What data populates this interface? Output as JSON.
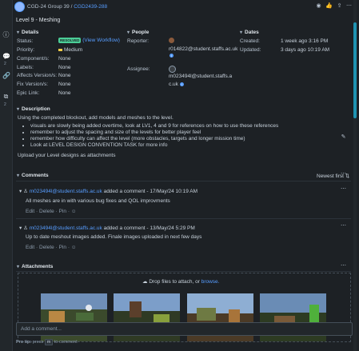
{
  "breadcrumb": {
    "project": "CGD-24 Group 39",
    "separator": "/",
    "issue_key": "CGD2439-288"
  },
  "issue_title": "Level 9 - Meshing",
  "rail": {
    "comments_count": "2"
  },
  "details": {
    "heading": "Details",
    "status_label": "Status:",
    "status_value": "RESOLVED",
    "status_link": "(View Workflow)",
    "priority_label": "Priority:",
    "priority_value": "Medium",
    "component_label": "Component/s:",
    "component_value": "None",
    "labels_label": "Labels:",
    "labels_value": "None",
    "affects_label": "Affects Version/s:",
    "affects_value": "None",
    "fix_label": "Fix Version/s:",
    "fix_value": "None",
    "epic_label": "Epic Link:",
    "epic_value": "None"
  },
  "people": {
    "heading": "People",
    "reporter_label": "Reporter:",
    "reporter_value": "r014822@student.staffs.ac.uk",
    "assignee_label": "Assignee:",
    "assignee_value_1": "m023494l@student.staffs.a",
    "assignee_value_2": "c.uk"
  },
  "dates": {
    "heading": "Dates",
    "created_label": "Created:",
    "created_value": "1 week ago 3:16 PM",
    "updated_label": "Updated:",
    "updated_value": "3 days ago 10:19 AM"
  },
  "description": {
    "heading": "Description",
    "intro": "Using the completed blockout, add models and meshes to the level.",
    "bullets": [
      "visuals are slowly being added overtime, look at LV1, 4 and 9 for references on how to use these references",
      "remember to adjust the spacing and size of the levels for better player feel",
      "remember how difficulty can affect the level (more obstacles, targets and longer mission time)",
      "Look at LEVEL DESIGN CONVENTION TASK for more info"
    ],
    "outro": "Upload your Level designs as attachments"
  },
  "comments": {
    "heading": "Comments",
    "sort": "Newest first",
    "items": [
      {
        "author": "m023494l@student.staffs.ac.uk",
        "meta": "added a comment - 17/May/24 10:19 AM",
        "body": "All meshes are in with various bug fixes and QOL improvments"
      },
      {
        "author": "m023494l@student.staffs.ac.uk",
        "meta": "added a comment - 13/May/24 5:29 PM",
        "body": "Up to date meshout images added. Finale images uploaded in next few days"
      }
    ],
    "edit": "Edit",
    "delete": "Delete",
    "pin": "Pin",
    "dot": "·"
  },
  "attachments": {
    "heading": "Attachments",
    "drop_text": "Drop files to attach, or",
    "browse": "browse."
  },
  "add_comment": {
    "placeholder": "Add a comment..."
  },
  "protip": {
    "prefix": "Pro tip:",
    "press": "press",
    "key": "m",
    "suffix": "to comment"
  },
  "colors": {
    "background": "#1d2125",
    "link": "#579dff",
    "resolved": "#4bce97",
    "scroll": "#1f93b2"
  }
}
